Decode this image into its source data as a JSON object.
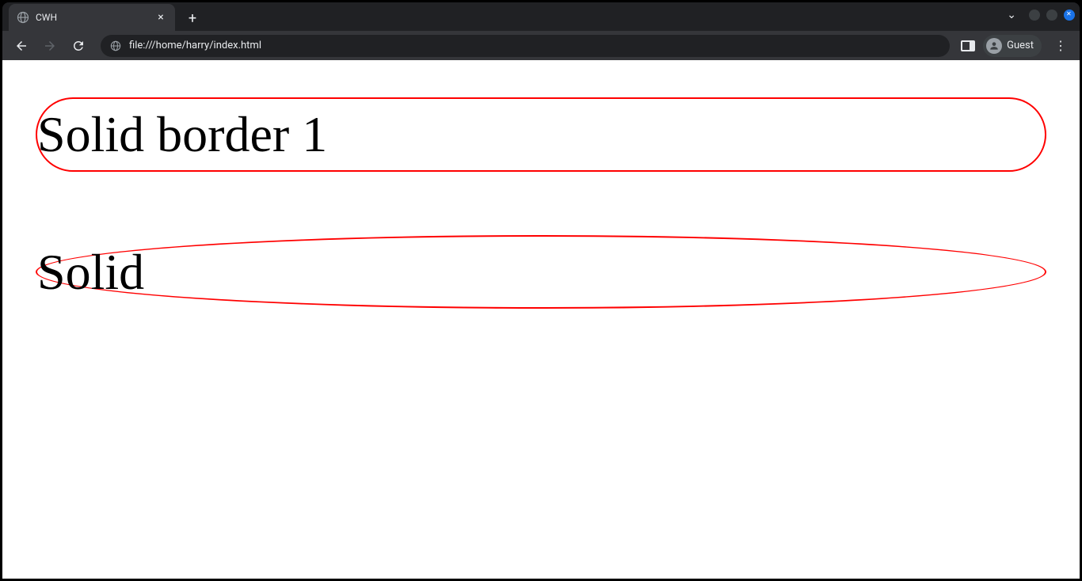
{
  "browser": {
    "tab": {
      "title": "CWH"
    },
    "address": {
      "url": "file:///home/harry/index.html"
    },
    "guest_label": "Guest"
  },
  "page": {
    "paragraph1": "Solid border 1",
    "paragraph2": "Solid"
  }
}
